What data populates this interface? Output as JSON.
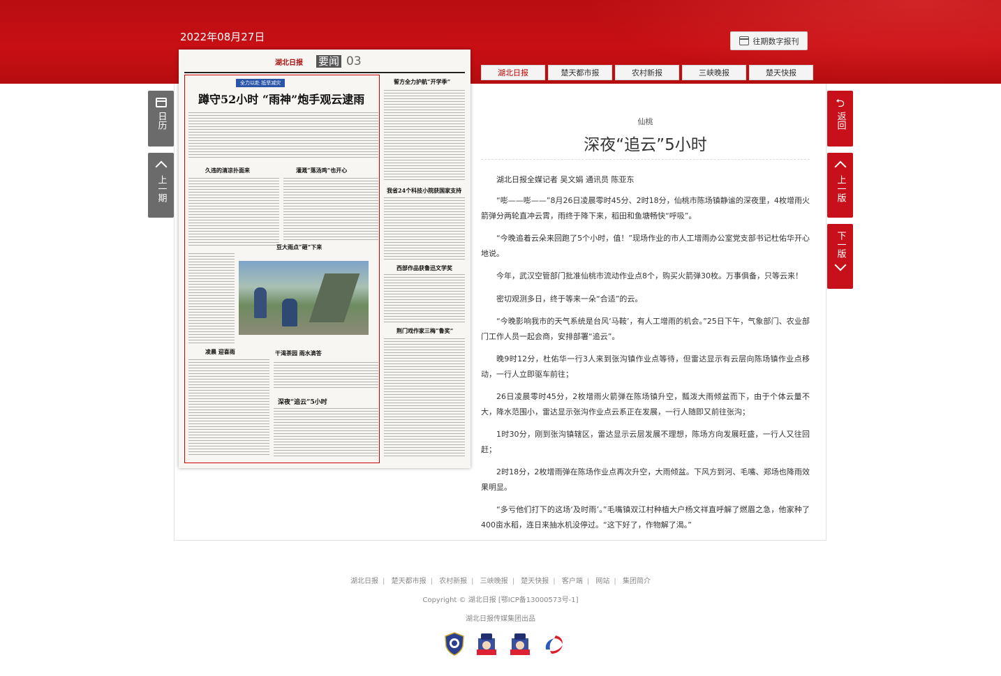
{
  "header": {
    "date": "2022年08月27日",
    "archive_label": "往期数字报刊"
  },
  "tabs": [
    {
      "label": "湖北日报",
      "active": true
    },
    {
      "label": "楚天都市报",
      "active": false
    },
    {
      "label": "农村新报",
      "active": false
    },
    {
      "label": "三峡晚报",
      "active": false
    },
    {
      "label": "楚天快报",
      "active": false
    }
  ],
  "left_nav": {
    "calendar": "日历",
    "prev_issue": "上一期"
  },
  "right_nav": {
    "back": "返回",
    "prev_page": "上一版",
    "next_page": "下一版"
  },
  "newspaper": {
    "masthead": "湖北日报",
    "section": "要闻",
    "page_number": "03",
    "tag": "全力以赴 抵旱减灾",
    "headline_main": "蹲守52小时 “雨神”炮手观云逮雨",
    "headline_right": "誓方全力护航“开学季”",
    "headline_science": "我省24个科技小院获国家支持",
    "headline_cool": "久违的清凉扑面来",
    "headline_irrigation": "灌溉“落汤鸡”也开心",
    "headline_rain": "豆大雨点“砸”下来",
    "headline_literature": "西部作品获鲁迅文学奖",
    "headline_tea": "干渴茶园 雨水滴答",
    "headline_rain2": "凌晨 迎喜雨",
    "headline_chase": "深夜“追云”5小时",
    "headline_drama": "荆门戏作家三梅“鲁奖”"
  },
  "article": {
    "kicker": "仙桃",
    "title": "深夜“追云”5小时",
    "byline": "湖北日报全媒记者 吴文娟 通讯员 陈亚东",
    "paragraphs": [
      "“嘭——嘭——”8月26日凌晨零时45分、2时18分，仙桃市陈场镇静谧的深夜里，4枚增雨火箭弹分两轮直冲云霄，雨终于降下来，稻田和鱼塘畅快“呼吸”。",
      "“今晚追着云朵来回跑了5个小时，值！”现场作业的市人工增雨办公室党支部书记杜佑华开心地说。",
      "今年，武汉空管部门批准仙桃市流动作业点8个，购买火箭弹30枚。万事俱备，只等云来！",
      "密切观测多日，终于等来一朵“合适”的云。",
      "“今晚影响我市的天气系统是台风‘马鞍’，有人工增雨的机会。”25日下午，气象部门、农业部门工作人员一起会商，安排部署“追云”。",
      "晚9时12分，杜佑华一行3人来到张沟镇作业点等待，但雷达显示有云层向陈场镇作业点移动，一行人立即驱车前往；",
      "26日凌晨零时45分，2枚增雨火箭弹在陈场镇升空，瓢泼大雨倾盆而下，由于个体云量不大，降水范围小，雷达显示张沟作业点云系正在发展，一行人随即又前往张沟；",
      "1时30分，刚到张沟镇辖区，雷达显示云层发展不理想，陈场方向发展旺盛，一行人又往回赶；",
      "2时18分，2枚增雨弹在陈场作业点再次升空，大雨倾盆。下风方到河、毛嘴、郑场也降雨效果明显。",
      "“多亏他们打下的这场‘及时雨’。”毛嘴镇双江村种植大户杨文祥直呼解了燃眉之急，他家种了400亩水稻，连日来抽水机没停过。“这下好了，作物解了渴。”"
    ]
  },
  "footer": {
    "links": [
      "湖北日报",
      "楚天都市报",
      "农村新报",
      "三峡晚报",
      "楚天快报",
      "客户端",
      "网站",
      "集团简介"
    ],
    "copyright": "Copyright © 湖北日报 [鄂ICP备13000573号-1]",
    "producer": "湖北日报传媒集团出品",
    "badges": [
      "police-badge-icon",
      "net-police-icon",
      "net-police-icon",
      "report-logo-icon"
    ]
  },
  "colors": {
    "brand_red": "#c80f14",
    "nav_gray": "#6b6b6b",
    "active_tab": "#cc0000"
  }
}
